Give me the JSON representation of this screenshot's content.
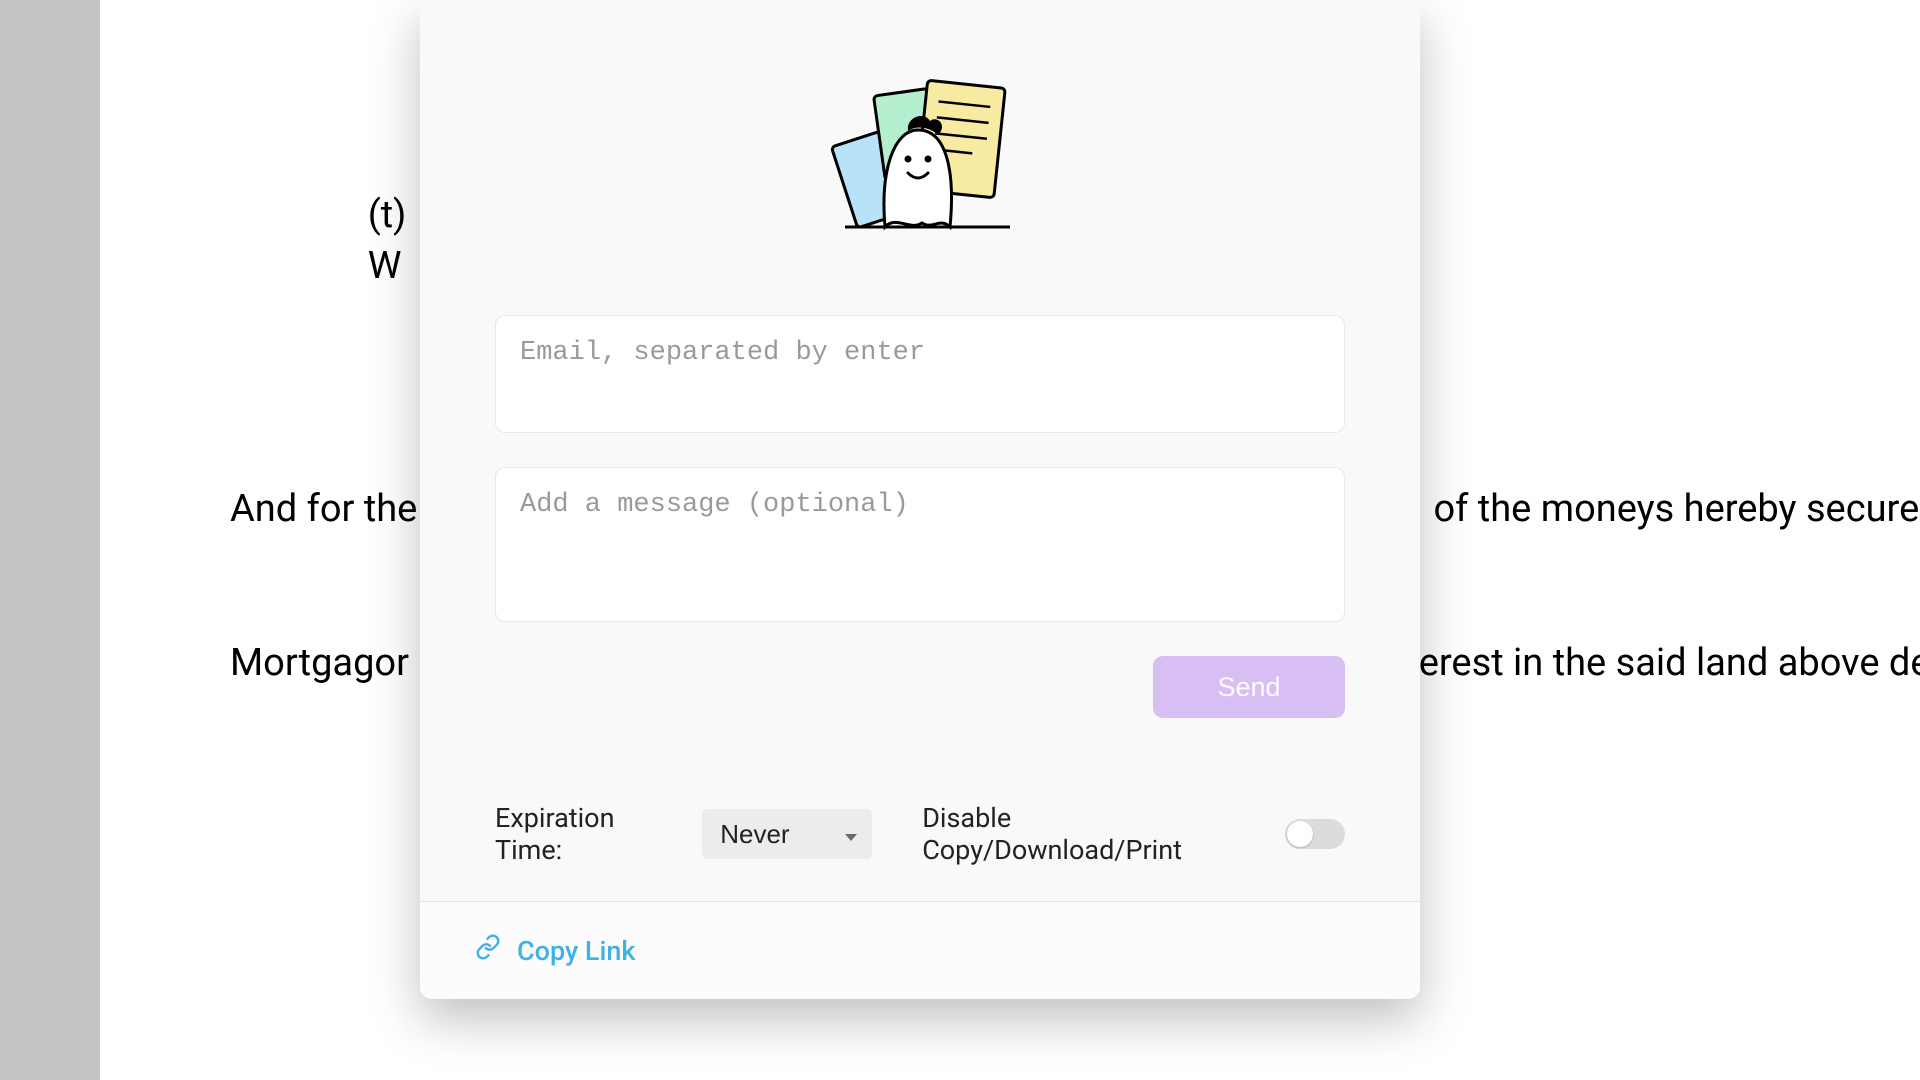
{
  "background_doc": {
    "clause_letter": "(t)",
    "clause_start": "W",
    "para_line1": "And for the bet",
    "para_line1_right": "of the moneys hereby secured, t",
    "para_line2": "Mortgagor here",
    "para_line2_right": "erest in the said land above desc"
  },
  "modal": {
    "email_placeholder": "Email, separated by enter",
    "message_placeholder": "Add a message (optional)",
    "send_label": "Send",
    "expiration_label": "Expiration Time:",
    "expiration_value": "Never",
    "disable_label": "Disable Copy/Download/Print",
    "copy_link_label": "Copy Link",
    "toggle_on": false
  }
}
